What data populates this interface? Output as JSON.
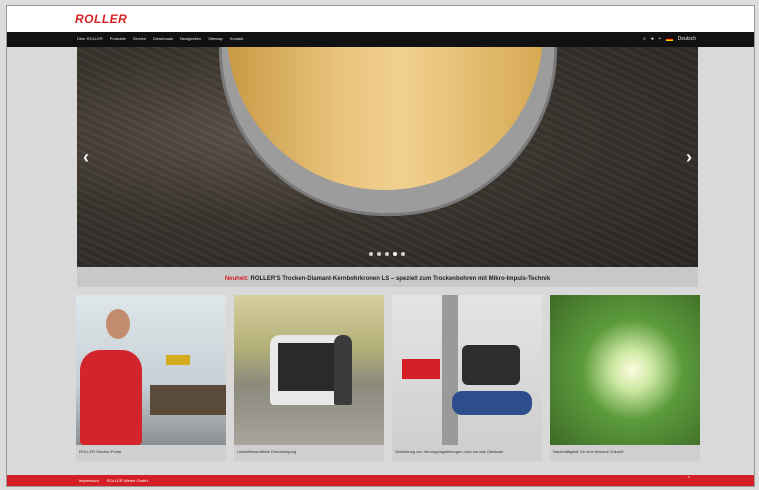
{
  "header": {
    "logo_text": "ROLLER"
  },
  "nav": {
    "items": [
      "Über ROLLER",
      "Produkte",
      "Service",
      "Downloads",
      "Neuigkeiten",
      "Sitemap",
      "Kontakt"
    ],
    "tool_icons": [
      "search-icon",
      "user-icon",
      "cart-icon"
    ],
    "language": "Deutsch"
  },
  "hero": {
    "prev_arrow": "‹",
    "next_arrow": "›",
    "slide_count": 5,
    "active_slide": 4,
    "caption_highlight": "Neuheit:",
    "caption_text": "ROLLER'S Trocken-Diamant-Kernbohrkronen LS – speziell zum Trockenbohren mit Mikro-Impuls-Technik"
  },
  "tiles": [
    {
      "label": "ROLLER Service-Portal",
      "image": "technician-workbench"
    },
    {
      "label": "Umweltfreundliche Rohrreinigung",
      "image": "service-van"
    },
    {
      "label": "Verklebung von Versorgungsleitungen rund um das Gebäude",
      "image": "pipe-tool"
    },
    {
      "label": "Nachhaltigkeit: für eine bessere Zukunft",
      "image": "sunlit-tree"
    }
  ],
  "footer": {
    "items": [
      "Impressum",
      "ROLLER Werke GmbH"
    ],
    "up_arrow": "^"
  },
  "colors": {
    "brand_red": "#d51f26",
    "nav_bg": "#111111"
  }
}
